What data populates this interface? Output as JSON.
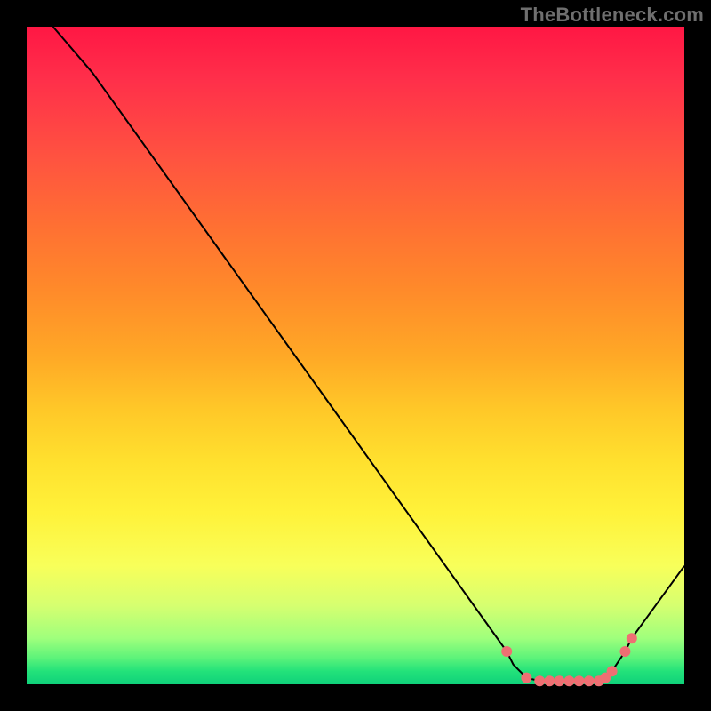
{
  "attribution": "TheBottleneck.com",
  "chart_data": {
    "type": "line",
    "title": "",
    "xlabel": "",
    "ylabel": "",
    "xlim": [
      0,
      100
    ],
    "ylim": [
      0,
      100
    ],
    "series": [
      {
        "name": "bottleneck-curve",
        "x": [
          4,
          10,
          73,
          74,
          76,
          78,
          80,
          82,
          84,
          86,
          88,
          89,
          91,
          92,
          100
        ],
        "y": [
          100,
          93,
          5,
          3,
          1,
          0.5,
          0.5,
          0.5,
          0.5,
          0.5,
          1,
          2,
          5,
          7,
          18
        ],
        "stroke": "#000000",
        "stroke_width": 2
      }
    ],
    "markers": {
      "name": "highlight-points",
      "x": [
        73,
        76,
        78,
        79.5,
        81,
        82.5,
        84,
        85.5,
        87,
        88,
        89,
        91,
        92
      ],
      "y": [
        5,
        1,
        0.5,
        0.5,
        0.5,
        0.5,
        0.5,
        0.5,
        0.5,
        1,
        2,
        5,
        7
      ],
      "color": "#ef6f73",
      "radius": 6
    }
  }
}
